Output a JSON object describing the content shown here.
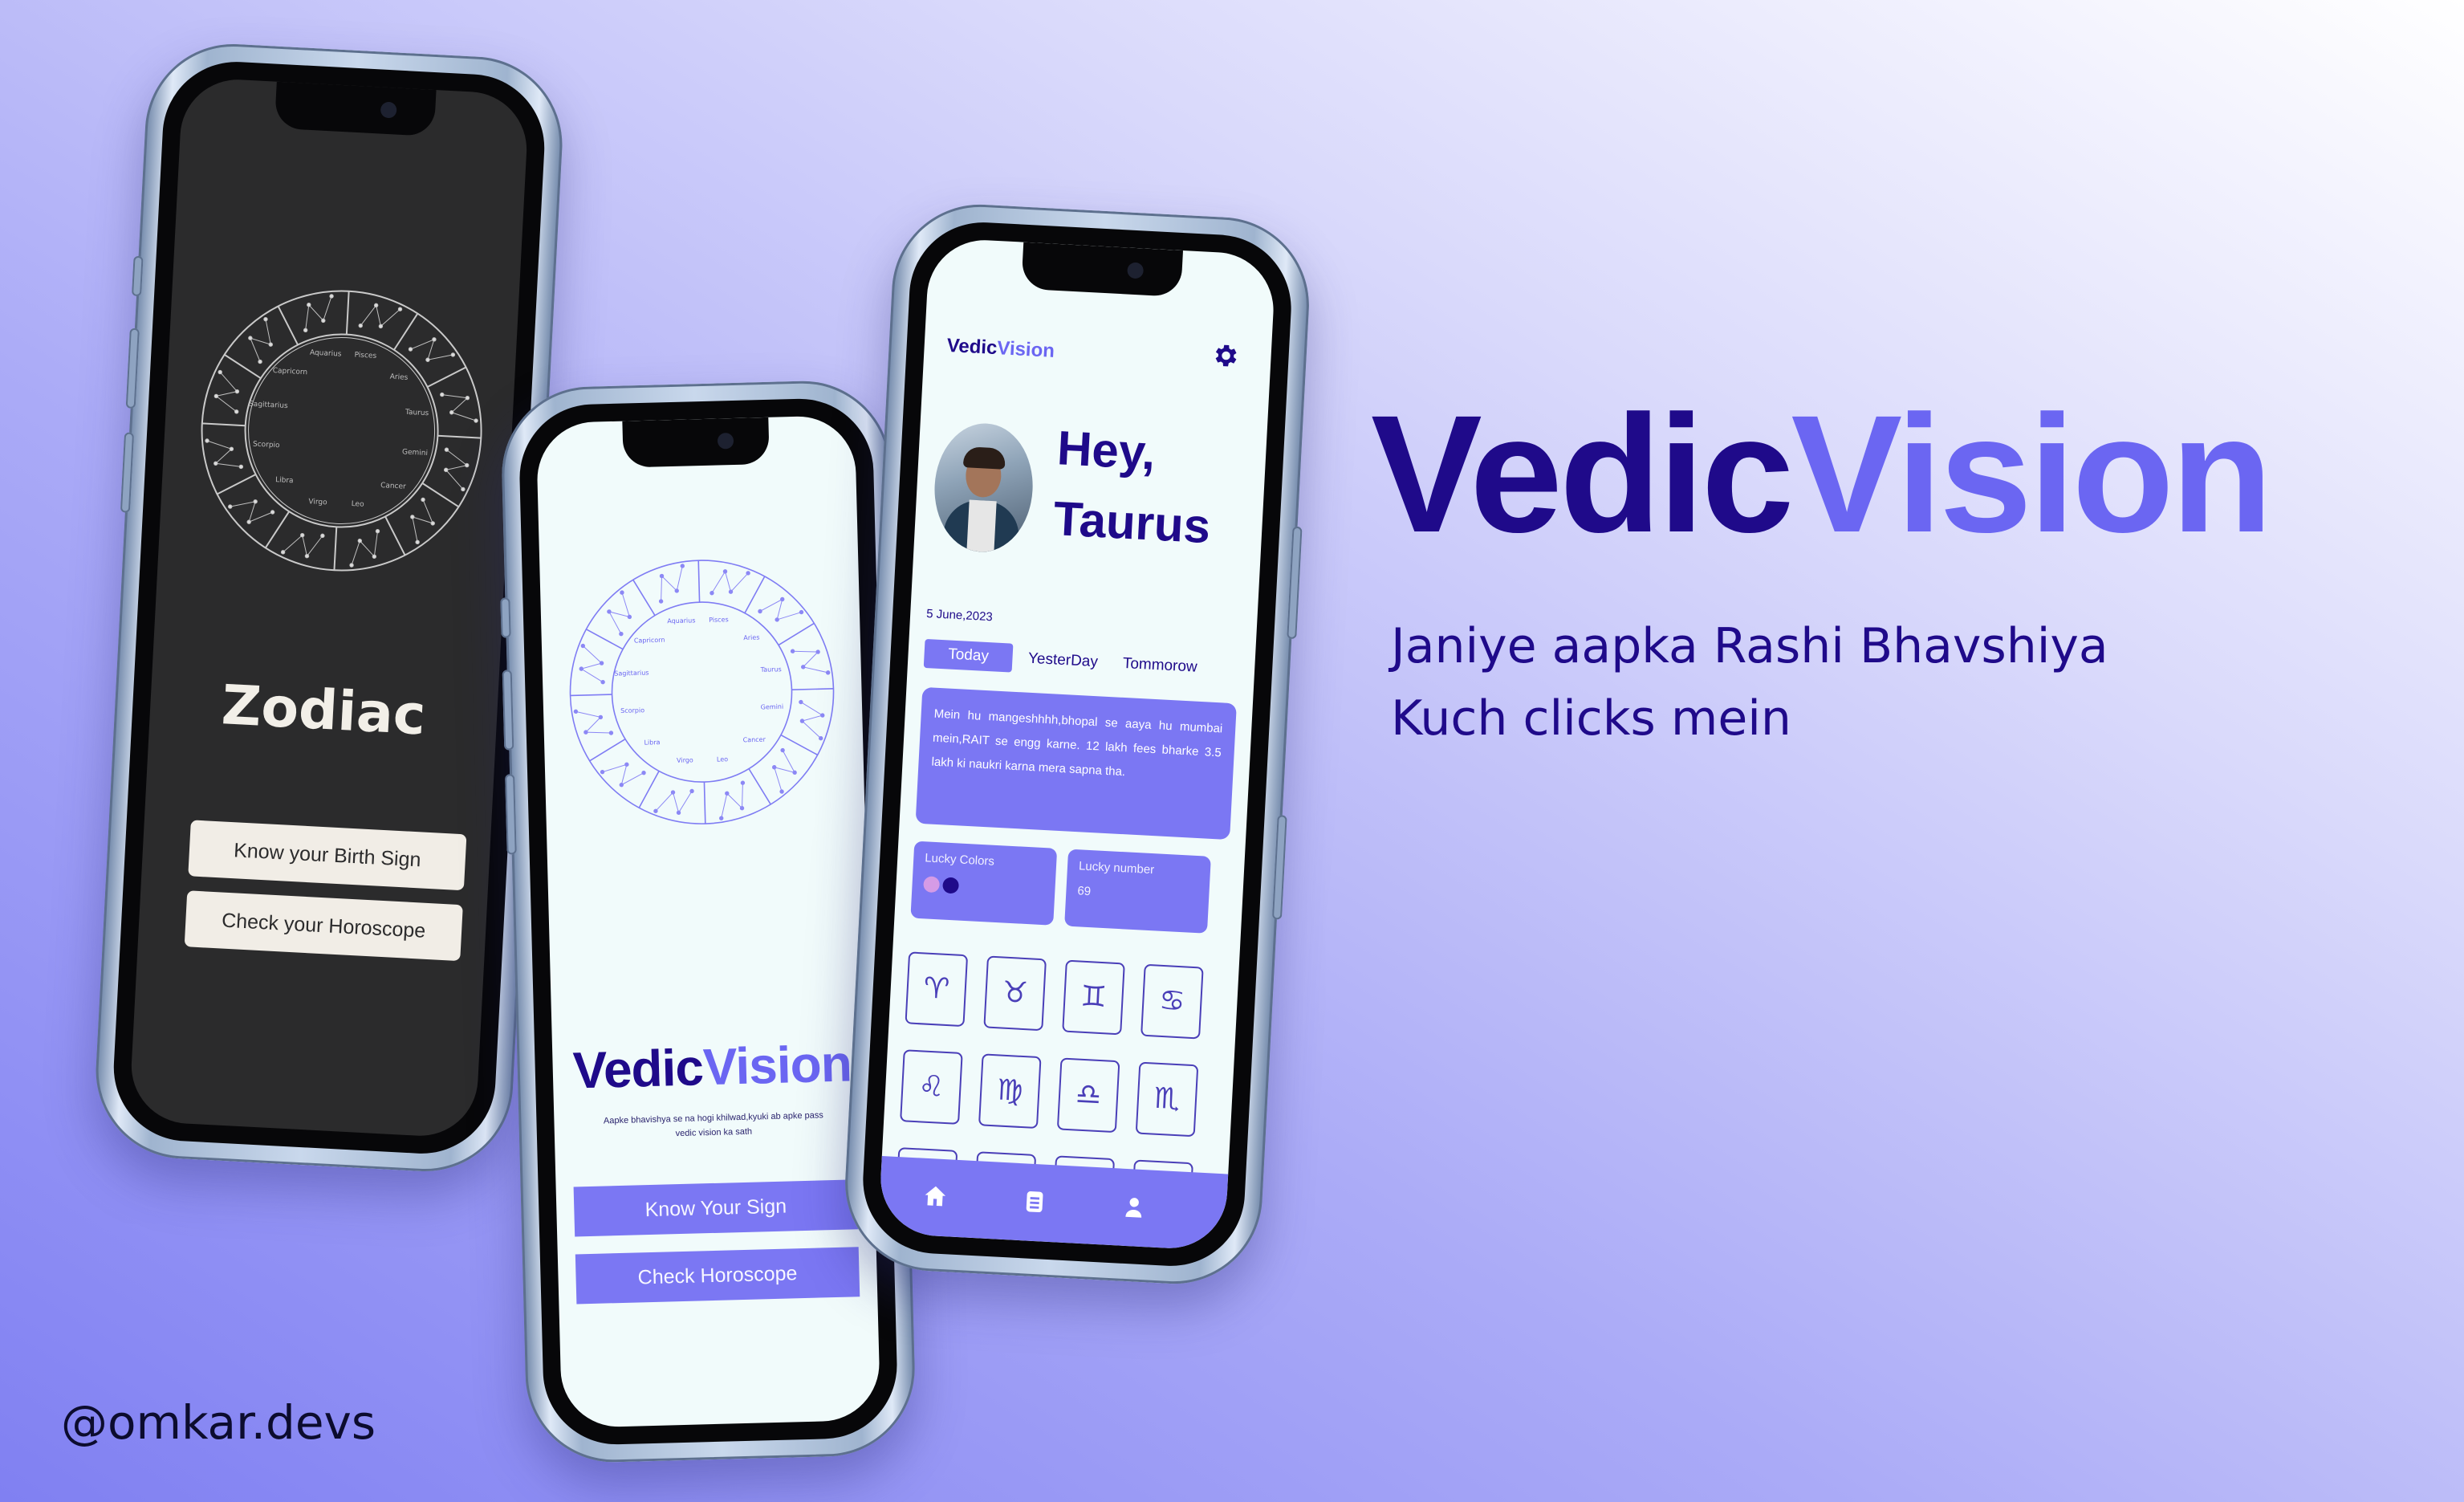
{
  "hero": {
    "brand_part1": "Vedic",
    "brand_part2": "Vision"
  },
  "tagline": {
    "line1": "Janiye aapka Rashi Bhavshiya",
    "line2": "Kuch clicks mein"
  },
  "handle": "@omkar.devs",
  "colors": {
    "primary": "#1f0a8a",
    "accent": "#6b66f2",
    "button": "#7b77f3",
    "dark_screen": "#2b2b2c"
  },
  "phone1": {
    "title": "Zodiac",
    "buttons": [
      "Know your Birth Sign",
      "Check your Horoscope"
    ],
    "wheel_labels": [
      "Pisces",
      "Aries",
      "Taurus",
      "Gemini",
      "Cancer",
      "Leo",
      "Virgo",
      "Libra",
      "Scorpio",
      "Sagittarius",
      "Capricorn",
      "Aquarius"
    ]
  },
  "phone2": {
    "brand_part1": "Vedic",
    "brand_part2": "Vision",
    "tagline_line1": "Aapke bhavishya se na hogi khilwad,kyuki ab apke pass",
    "tagline_line2": "vedic vision ka sath",
    "buttons": [
      "Know Your Sign",
      "Check Horoscope"
    ]
  },
  "phone3": {
    "brand_part1": "Vedic",
    "brand_part2": "Vision",
    "greeting_line1": "Hey,",
    "greeting_line2": "Taurus",
    "date": "5 June,2023",
    "tabs": [
      "Today",
      "YesterDay",
      "Tommorow"
    ],
    "horoscope_text": "Mein hu mangeshhhh,bhopal se aaya hu mumbai mein,RAIT se engg karne. 12 lakh fees bharke 3.5 lakh ki naukri karna mera sapna tha.",
    "lucky_colors_label": "Lucky Colors",
    "lucky_colors": [
      "#d59be6",
      "#1f0a8a"
    ],
    "lucky_number_label": "Lucky number",
    "lucky_number": "69",
    "signs": [
      "♈",
      "♉",
      "♊",
      "♋",
      "♌",
      "♍",
      "♎",
      "♏",
      "♐",
      "♑",
      "♒",
      "♓"
    ],
    "nav_icons": [
      "home-icon",
      "document-icon",
      "profile-icon"
    ]
  }
}
